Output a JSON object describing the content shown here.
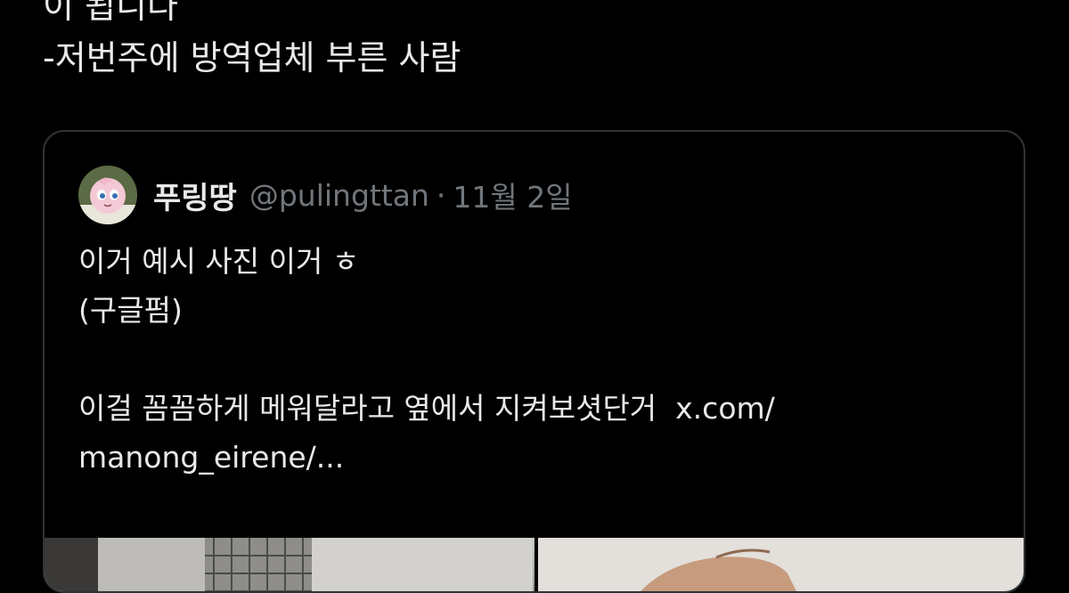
{
  "main_tweet": {
    "lines": [
      "이 됩니다",
      "-저번주에 방역업체 부른 사람"
    ]
  },
  "quoted_tweet": {
    "display_name": "푸링땅",
    "handle": "@pulingttan",
    "separator": "·",
    "date": "11월 2일",
    "body": {
      "line1": "이거 예시 사진 이거 ㅎ",
      "line2": "(구글펌)",
      "line3_text": "이걸 꼼꼼하게 메워달라고 옆에서 지켜보셧단거",
      "line3_link": "x.com/",
      "line4_link": "manong_eirene/..."
    }
  }
}
